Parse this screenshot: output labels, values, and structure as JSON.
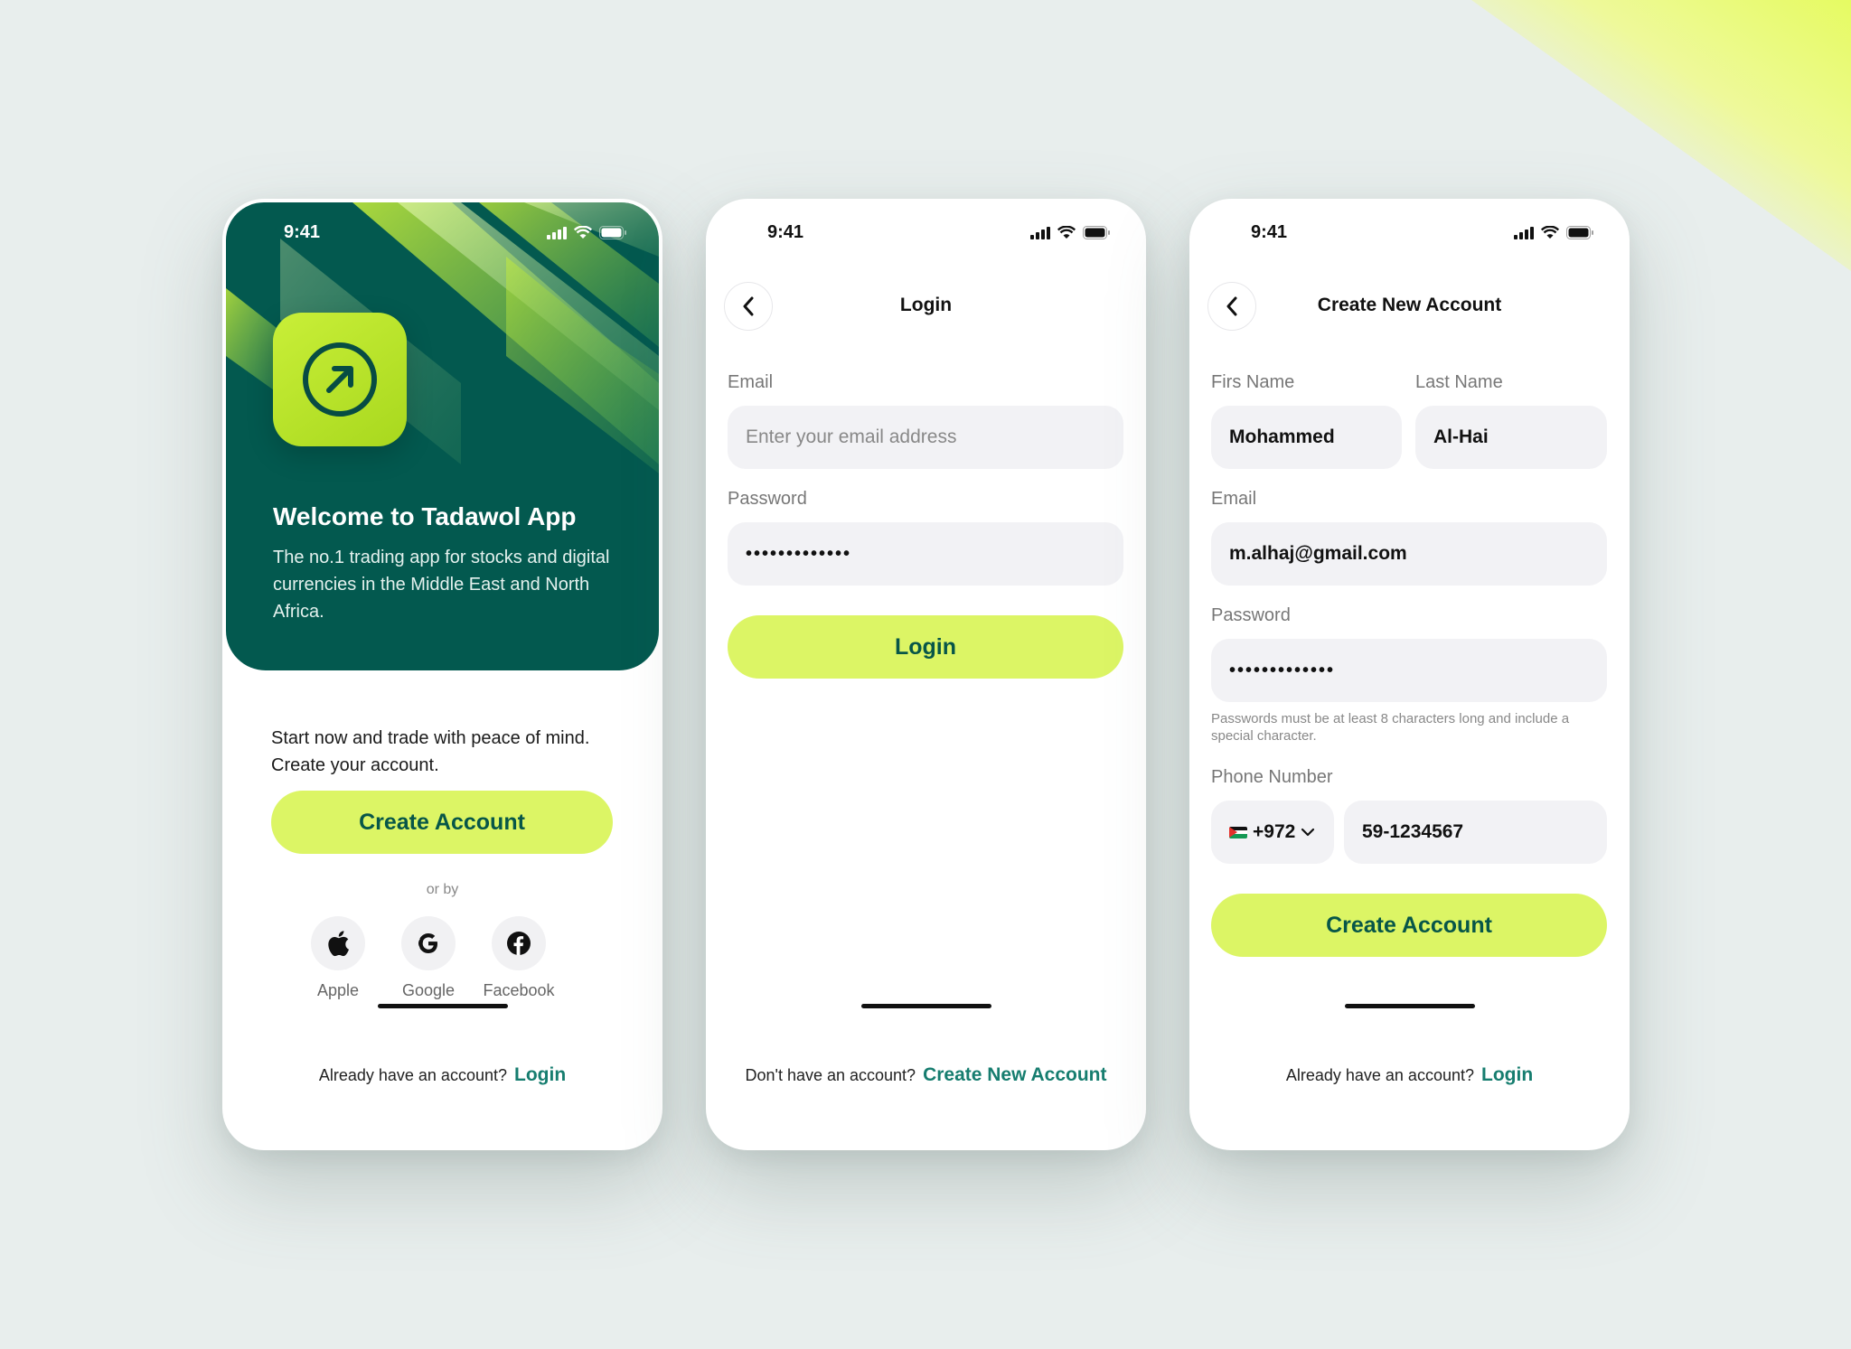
{
  "colors": {
    "brand_dark": "#03594f",
    "accent_lime": "#dcf565",
    "link_teal": "#167d6f",
    "button_text": "#075648"
  },
  "status_bar": {
    "time": "9:41"
  },
  "welcome_screen": {
    "title": "Welcome to Tadawol App",
    "subtitle": "The no.1 trading app for stocks and digital currencies in the Middle East and North Africa.",
    "intro": "Start now and trade with peace of mind. Create your account.",
    "create_account_label": "Create Account",
    "or_by": "or by",
    "socials": [
      {
        "label": "Apple",
        "icon": "apple-icon"
      },
      {
        "label": "Google",
        "icon": "google-icon"
      },
      {
        "label": "Facebook",
        "icon": "facebook-icon"
      }
    ],
    "footer_text": "Already have an account?",
    "footer_link": "Login"
  },
  "login_screen": {
    "title": "Login",
    "email_label": "Email",
    "email_placeholder": "Enter your email address",
    "password_label": "Password",
    "password_value": "•••••••••••••",
    "login_label": "Login",
    "footer_text": "Don't have an account?",
    "footer_link": "Create New Account"
  },
  "signup_screen": {
    "title": "Create New Account",
    "first_name_label": "Firs Name",
    "first_name_value": "Mohammed",
    "last_name_label": "Last Name",
    "last_name_value": "Al-Hai",
    "email_label": "Email",
    "email_value": "m.alhaj@gmail.com",
    "password_label": "Password",
    "password_value": "•••••••••••••",
    "password_hint": "Passwords must be at least 8 characters long and include a special character.",
    "phone_label": "Phone Number",
    "country_code": "+972",
    "phone_value": "59-1234567",
    "create_account_label": "Create Account",
    "footer_text": "Already have an account?",
    "footer_link": "Login"
  }
}
